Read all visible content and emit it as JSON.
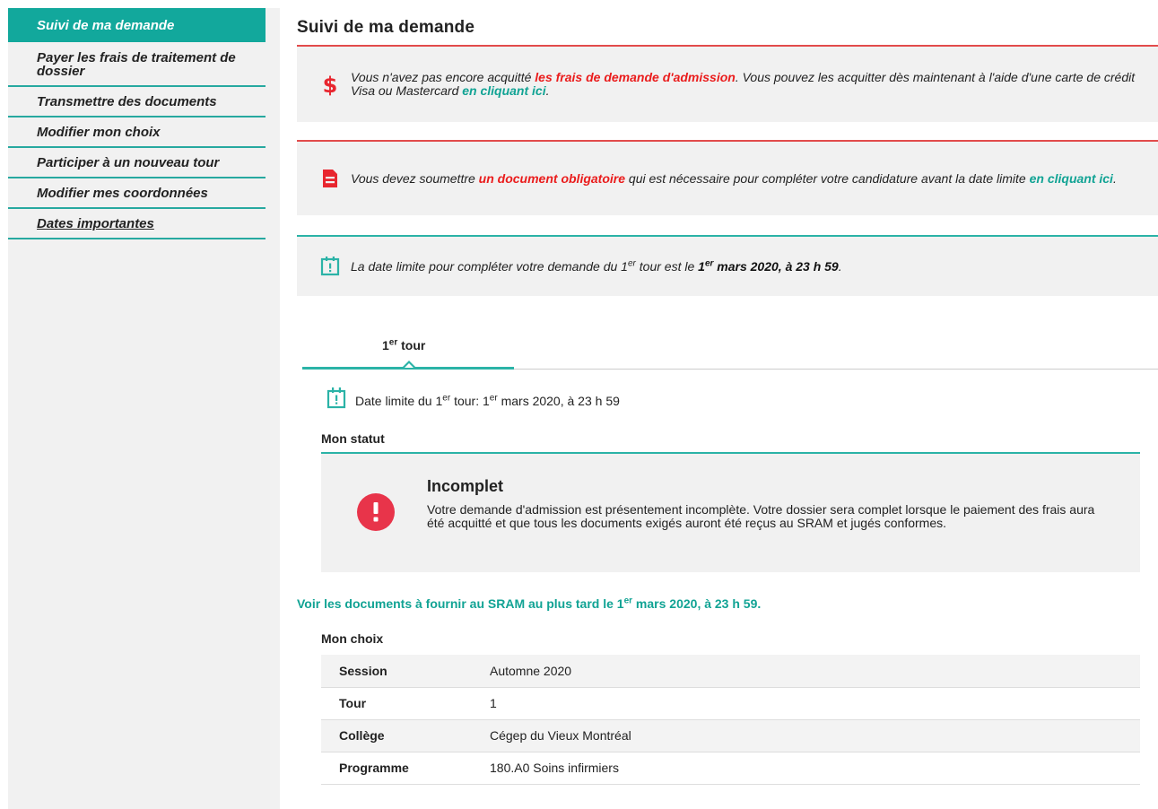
{
  "sidebar": {
    "items": [
      {
        "label": "Suivi de ma demande"
      },
      {
        "label": "Payer les frais de traitement de dossier"
      },
      {
        "label": "Transmettre des documents"
      },
      {
        "label": "Modifier mon choix"
      },
      {
        "label": "Participer à un nouveau tour"
      },
      {
        "label": "Modifier mes coordonnées"
      },
      {
        "label": "Dates importantes"
      }
    ]
  },
  "page": {
    "title": "Suivi de ma demande"
  },
  "alerts": {
    "fees": {
      "text_before": "Vous n'avez pas encore acquitté ",
      "strong": "les frais de demande d'admission",
      "text_after": ". Vous pouvez les acquitter dès maintenant à l'aide d'une carte de crédit Visa ou Mastercard ",
      "link": "en cliquant ici",
      "end": "."
    },
    "document": {
      "text_before": "Vous devez soumettre ",
      "strong": "un document obligatoire",
      "text_after": " qui est nécessaire pour compléter votre candidature avant la date limite ",
      "link": "en cliquant ici",
      "end": "."
    },
    "deadline": {
      "text_before": "La date limite pour compléter votre demande du 1",
      "sup1": "er",
      "text_mid": " tour est le ",
      "strong_a": "1",
      "sup2": "er",
      "strong_b": " mars 2020, à 23 h 59",
      "end": "."
    }
  },
  "colors": {
    "accent": "#12a89c",
    "alert_red": "#e24b4b",
    "link_teal": "#11a394",
    "status_red": "#e8344a"
  },
  "tabs": [
    {
      "label": "1",
      "sup": "er",
      "label_after": " tour"
    }
  ],
  "round": {
    "deadline_text_a": "Date limite du 1",
    "deadline_sup1": "er",
    "deadline_text_b": " tour: 1",
    "deadline_sup2": "er",
    "deadline_text_c": " mars 2020, à 23 h 59",
    "status_heading": "Mon statut",
    "status": {
      "title": "Incomplet",
      "description": "Votre demande d'admission est présentement incomplète. Votre dossier sera complet lorsque le paiement des frais aura été acquitté et que tous les documents exigés auront été reçus au SRAM et jugés conformes."
    },
    "docs_link_a": "Voir les documents à fournir au SRAM au plus tard le 1",
    "docs_link_sup": "er",
    "docs_link_b": " mars 2020, à 23 h 59.",
    "choice_heading": "Mon choix",
    "choice_rows": [
      {
        "label": "Session",
        "value": "Automne 2020"
      },
      {
        "label": "Tour",
        "value": "1"
      },
      {
        "label": "Collège",
        "value": "Cégep du Vieux Montréal"
      },
      {
        "label": "Programme",
        "value": "180.A0 Soins infirmiers"
      }
    ]
  }
}
